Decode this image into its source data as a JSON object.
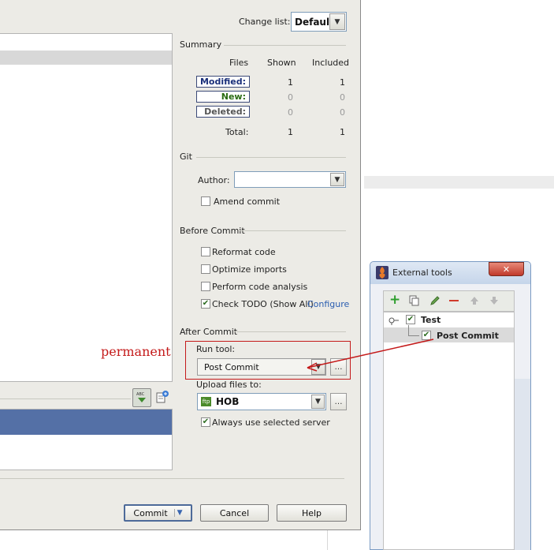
{
  "changelist": {
    "label": "Change list:",
    "value": "Default"
  },
  "summary": {
    "title": "Summary",
    "columns": [
      "Files",
      "Shown",
      "Included"
    ],
    "rows": [
      {
        "label": "Modified:",
        "shown": "1",
        "included": "1",
        "color": "#1a2f7a"
      },
      {
        "label": "New:",
        "shown": "0",
        "included": "0",
        "color": "#2a6b12"
      },
      {
        "label": "Deleted:",
        "shown": "0",
        "included": "0",
        "color": "#555555"
      }
    ],
    "total": {
      "label": "Total:",
      "shown": "1",
      "included": "1"
    }
  },
  "git": {
    "title": "Git",
    "author_label": "Author:",
    "author_value": "",
    "amend": {
      "label": "Amend commit",
      "checked": false
    }
  },
  "before_commit": {
    "title": "Before Commit",
    "options": [
      {
        "label": "Reformat code",
        "checked": false
      },
      {
        "label": "Optimize imports",
        "checked": false
      },
      {
        "label": "Perform code analysis",
        "checked": false
      },
      {
        "label": "Check TODO (Show All)",
        "checked": true
      }
    ],
    "configure_link": "Configure"
  },
  "after_commit": {
    "title": "After Commit",
    "run_tool_label": "Run tool:",
    "run_tool_value": "Post Commit",
    "upload_label": "Upload files to:",
    "upload_value": "HOB",
    "always_use": {
      "label": "Always use selected server",
      "checked": true
    }
  },
  "annotation": {
    "text": "permanent",
    "color": "#c41a1a"
  },
  "buttons": {
    "commit": "Commit",
    "cancel": "Cancel",
    "help": "Help"
  },
  "external_tools": {
    "title": "External tools",
    "toolbar_icons": [
      "add-icon",
      "copy-icon",
      "edit-icon",
      "remove-icon",
      "move-up-icon",
      "move-down-icon"
    ],
    "tree": [
      {
        "label": "Test",
        "checked": true
      },
      {
        "label": "Post Commit",
        "checked": true
      }
    ]
  },
  "checkmark": "✔"
}
